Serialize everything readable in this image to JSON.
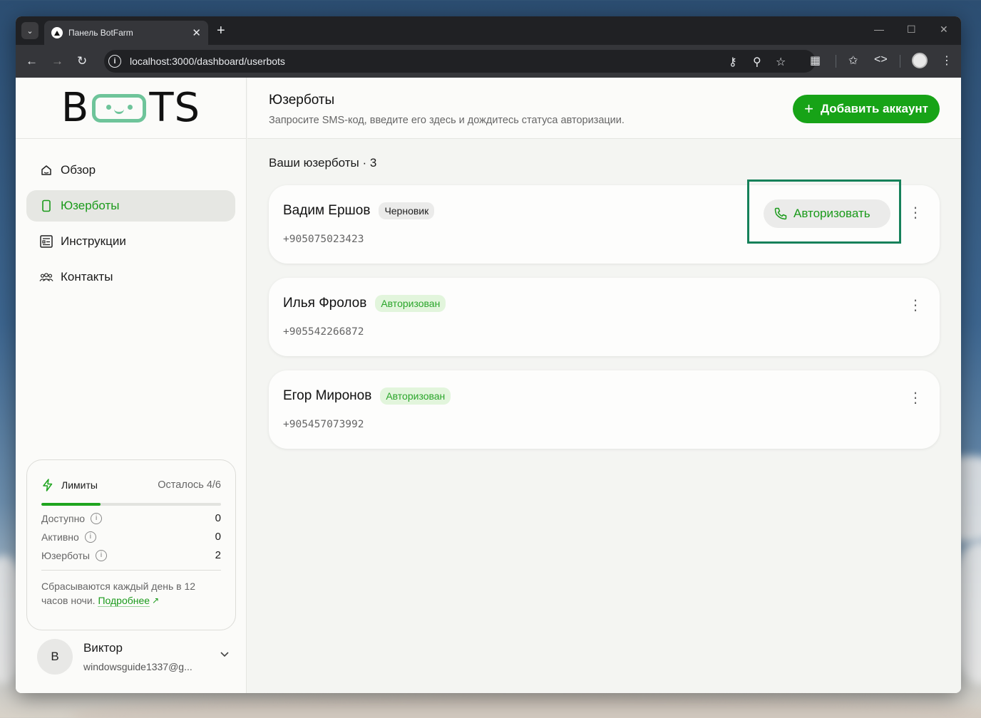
{
  "browser": {
    "tab_title": "Панель BotFarm",
    "url": "localhost:3000/dashboard/userbots"
  },
  "sidebar": {
    "logo_left": "B",
    "logo_right": "TS",
    "items": [
      {
        "label": "Обзор",
        "icon": "home-icon",
        "active": false
      },
      {
        "label": "Юзерботы",
        "icon": "phone-icon",
        "active": true
      },
      {
        "label": "Инструкции",
        "icon": "document-icon",
        "active": false
      },
      {
        "label": "Контакты",
        "icon": "users-icon",
        "active": false
      }
    ],
    "limits": {
      "title": "Лимиты",
      "remaining": "Осталось 4/6",
      "progress": 0.33,
      "rows": [
        {
          "label": "Доступно",
          "value": "0"
        },
        {
          "label": "Активно",
          "value": "0"
        },
        {
          "label": "Юзерботы",
          "value": "2"
        }
      ],
      "note": "Сбрасываются каждый день в 12 часов ночи.",
      "link": "Подробнее"
    },
    "user": {
      "initial": "В",
      "name": "Виктор",
      "email": "windowsguide1337@g..."
    }
  },
  "main": {
    "title": "Юзерботы",
    "subtitle": "Запросите SMS-код, введите его здесь и дождитесь статуса авторизации.",
    "add_button": "Добавить аккаунт",
    "section_title": "Ваши юзерботы · 3",
    "cards": [
      {
        "name": "Вадим Ершов",
        "status": "Черновик",
        "phone": "+905075023423",
        "action": "Авторизовать"
      },
      {
        "name": "Илья Фролов",
        "status": "Авторизован",
        "phone": "+905542266872"
      },
      {
        "name": "Егор Миронов",
        "status": "Авторизован",
        "phone": "+905457073992"
      }
    ]
  },
  "colors": {
    "accent": "#17a317",
    "logo_green": "#6ec49a",
    "highlight": "#16815a"
  }
}
